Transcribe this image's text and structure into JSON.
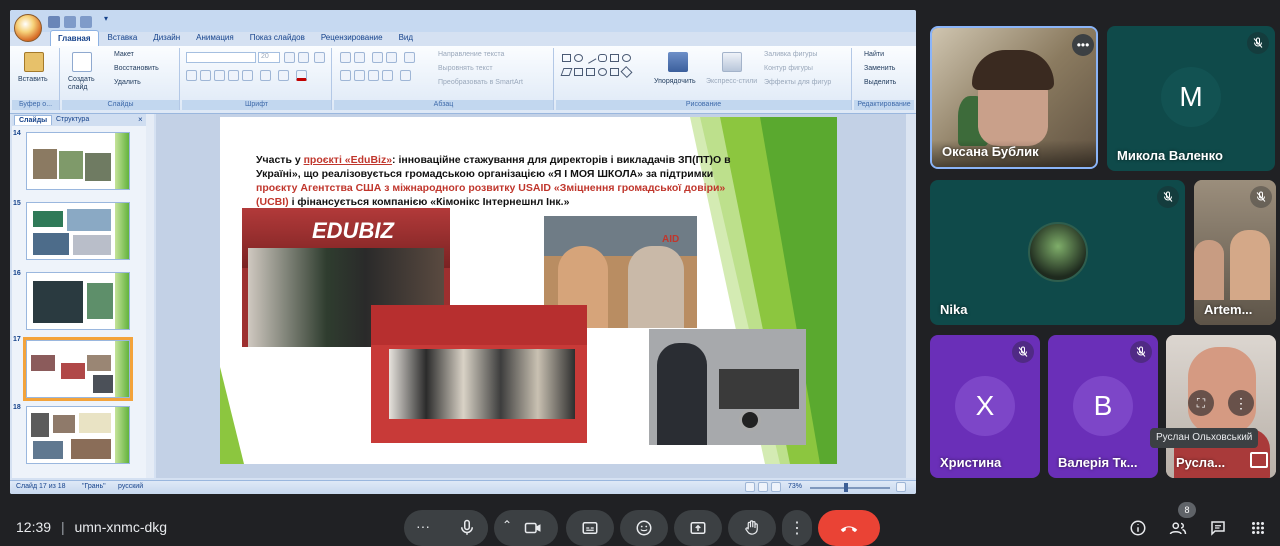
{
  "powerpoint": {
    "tabs": [
      "Главная",
      "Вставка",
      "Дизайн",
      "Анимация",
      "Показ слайдов",
      "Рецензирование",
      "Вид"
    ],
    "active_tab": "Главная",
    "groups": {
      "clipboard": {
        "label": "Буфер о...",
        "paste": "Вставить"
      },
      "slides": {
        "label": "Слайды",
        "create": "Создать слайд",
        "layout": "Макет",
        "restore": "Восстановить",
        "delete": "Удалить"
      },
      "font": {
        "label": "Шрифт",
        "size": "20"
      },
      "paragraph": {
        "label": "Абзац",
        "text_direction": "Направление текста",
        "align_text": "Выровнять текст",
        "smartart": "Преобразовать в SmartArt"
      },
      "drawing": {
        "label": "Рисование",
        "arrange": "Упорядочить",
        "quick_styles": "Экспресс-стили",
        "fill": "Заливка фигуры",
        "outline": "Контур фигуры",
        "effects": "Эффекты для фигур"
      },
      "editing": {
        "label": "Редактирование",
        "find": "Найти",
        "replace": "Заменить",
        "select": "Выделить"
      }
    },
    "pane_tabs": [
      "Слайды",
      "Структура"
    ],
    "thumbnails": [
      "14",
      "15",
      "16",
      "17",
      "18"
    ],
    "selected_slide": "17",
    "slide": {
      "text_1": "Участь у ",
      "link_1": "проєкті «EduBiz»",
      "text_2": ": інноваційне стажування для директорів  і викладачів  ЗП(ПТ)О в Україні», що реалізовується громадською організацією «Я І МОЯ ШКОЛА» за підтримки ",
      "link_2": "проєкту Агентства США з міжнародного розвитку USAID «Зміцнення громадської довіри» (UCBI)",
      "text_3": " і фінансується компанією «Кімонікс Інтернешнл Інк.»",
      "banner_text": "EDUBIZ",
      "banner_text_2": "AID"
    },
    "status": {
      "slide_info": "Слайд 17 из 18",
      "theme": "\"Грань\"",
      "language": "русский",
      "zoom": "73%"
    }
  },
  "participants": [
    {
      "name": "Оксана Бублик",
      "initial": ""
    },
    {
      "name": "Микола Валенко",
      "initial": "M"
    },
    {
      "name": "Nika",
      "initial": ""
    },
    {
      "name": "Artem...",
      "initial": ""
    },
    {
      "name": "Христина",
      "initial": "X"
    },
    {
      "name": "Валерія Тк...",
      "initial": "B"
    },
    {
      "name": "Русла...",
      "initial": ""
    }
  ],
  "tooltip": "Руслан Ольховський",
  "meeting": {
    "time": "12:39",
    "separator": "|",
    "code": "umn-xnmc-dkg",
    "people_count": "8"
  },
  "colors": {
    "accent_purple": "#6a2fb8",
    "teal_tile": "#0f4a4a",
    "end_call": "#ea4335",
    "control_bg": "#3c4043"
  }
}
